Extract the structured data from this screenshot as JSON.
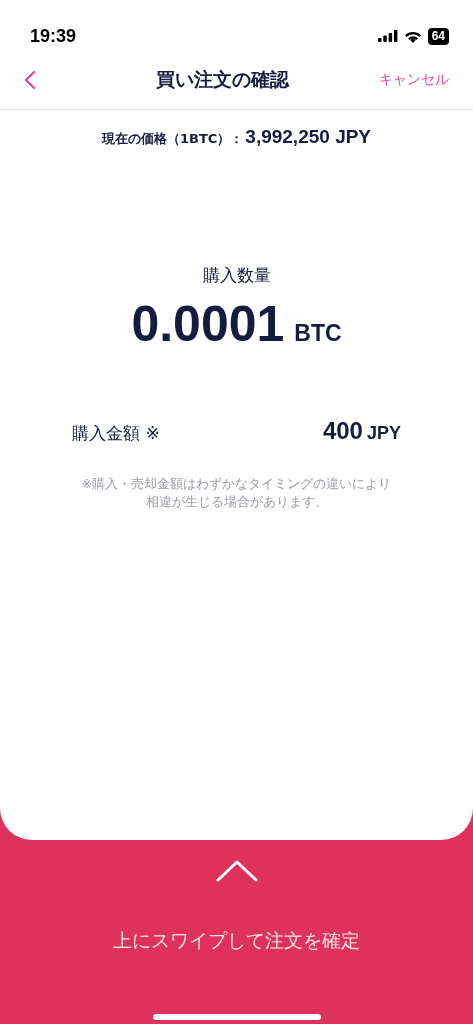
{
  "status_bar": {
    "time": "19:39",
    "battery": "64"
  },
  "header": {
    "title": "買い注文の確認",
    "cancel": "キャンセル"
  },
  "current_price": {
    "label": "現在の価格（1BTC）：",
    "value": "3,992,250 JPY"
  },
  "quantity": {
    "label": "購入数量",
    "value": "0.0001",
    "unit": "BTC"
  },
  "amount": {
    "label": "購入金額 ※",
    "value": "400",
    "unit": "JPY"
  },
  "note": "※購入・売却金額はわずかなタイミングの違いにより相違が生じる場合があります。",
  "swipe": {
    "label": "上にスワイプして注文を確定"
  }
}
